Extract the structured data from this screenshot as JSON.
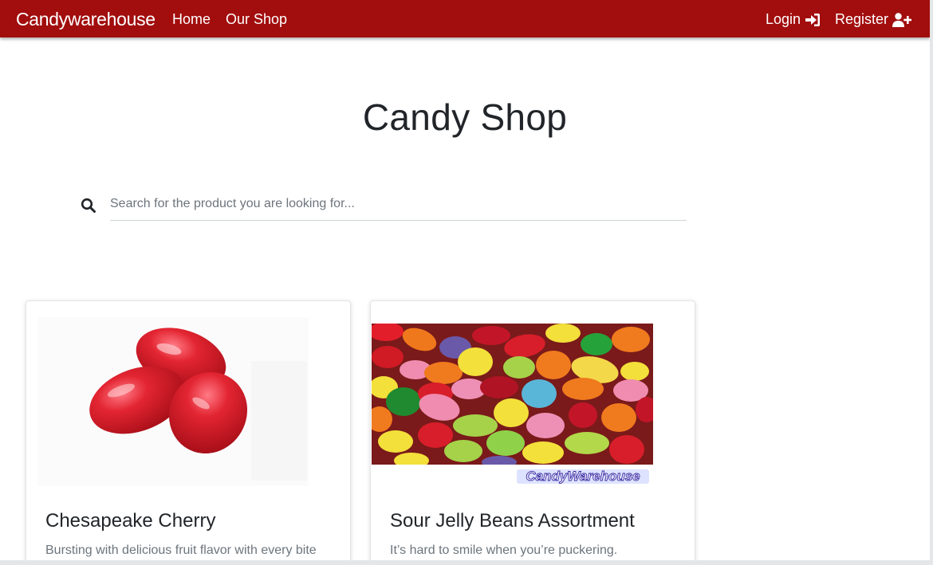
{
  "navbar": {
    "brand": "Candywarehouse",
    "links": [
      {
        "label": "Home"
      },
      {
        "label": "Our Shop"
      }
    ],
    "login_label": "Login",
    "register_label": "Register",
    "login_icon": "sign-in-icon",
    "register_icon": "user-plus-icon",
    "background_color": "#a20d0d"
  },
  "main": {
    "title": "Candy Shop",
    "search": {
      "placeholder": "Search for the product you are looking for...",
      "value": "",
      "icon": "search-icon"
    }
  },
  "products": [
    {
      "title": "Chesapeake Cherry",
      "description": "Bursting with delicious fruit flavor with every bite",
      "image": "red-cherry-jelly-beans"
    },
    {
      "title": "Sour Jelly Beans Assortment",
      "description": "It’s hard to smile when you’re puckering.",
      "image": "assorted-jelly-beans",
      "image_watermark": "CandyWarehouse"
    }
  ]
}
